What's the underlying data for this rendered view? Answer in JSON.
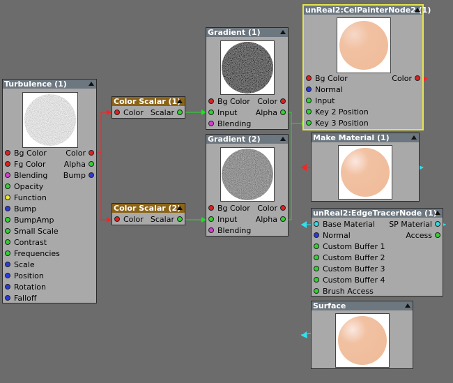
{
  "colors": {
    "canvas": "#6c6c6c",
    "node_bg": "#a9a9a9",
    "header": "#6d7780",
    "header_scalar": "#8c6418",
    "selected_outline": "#e4e44a",
    "wire_red": "#ff2020",
    "wire_green": "#22e022",
    "wire_cyan": "#30e0f0"
  },
  "nodes": {
    "turbulence": {
      "title": "Turbulence (1)",
      "inputs": [
        "Bg Color",
        "Fg Color",
        "Blending",
        "Opacity",
        "Function",
        "Bump",
        "BumpAmp",
        "Small Scale",
        "Contrast",
        "Frequencies",
        "Scale",
        "Position",
        "Rotation",
        "Falloff"
      ],
      "outputs": [
        "Color",
        "Alpha",
        "Bump"
      ]
    },
    "scalar1": {
      "title": "Color Scalar (1)",
      "input": "Color",
      "output": "Scalar"
    },
    "scalar2": {
      "title": "Color Scalar (2)",
      "input": "Color",
      "output": "Scalar"
    },
    "gradient1": {
      "title": "Gradient (1)",
      "inputs": [
        "Bg Color",
        "Input",
        "Blending"
      ],
      "outputs": [
        "Color",
        "Alpha"
      ]
    },
    "gradient2": {
      "title": "Gradient (2)",
      "inputs": [
        "Bg Color",
        "Input",
        "Blending"
      ],
      "outputs": [
        "Color",
        "Alpha"
      ]
    },
    "celpainter": {
      "title": "unReal2:CelPainterNode2 (1)",
      "inputs": [
        "Bg Color",
        "Normal",
        "Input",
        "Key 2 Position",
        "Key 3 Position"
      ],
      "outputs": [
        "Color"
      ]
    },
    "makematerial": {
      "title": "Make Material (1)"
    },
    "edgetracer": {
      "title": "unReal2:EdgeTracerNode (1)",
      "inputs": [
        "Base Material",
        "Normal",
        "Custom Buffer 1",
        "Custom Buffer 2",
        "Custom Buffer 3",
        "Custom Buffer 4",
        "Brush Access"
      ],
      "outputs": [
        "SP Material",
        "Access"
      ]
    },
    "surface": {
      "title": "Surface"
    }
  }
}
